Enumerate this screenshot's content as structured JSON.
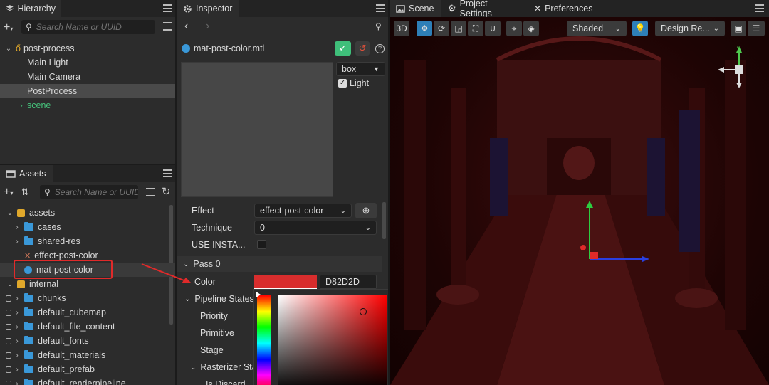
{
  "hierarchy": {
    "tab": "Hierarchy",
    "search_placeholder": "Search Name or UUID",
    "items": [
      {
        "label": "post-process"
      },
      {
        "label": "Main Light"
      },
      {
        "label": "Main Camera"
      },
      {
        "label": "PostProcess"
      },
      {
        "label": "scene"
      }
    ]
  },
  "assets": {
    "tab": "Assets",
    "search_placeholder": "Search Name or UUID",
    "items": [
      {
        "label": "assets"
      },
      {
        "label": "cases"
      },
      {
        "label": "shared-res"
      },
      {
        "label": "effect-post-color"
      },
      {
        "label": "mat-post-color"
      },
      {
        "label": "internal"
      },
      {
        "label": "chunks"
      },
      {
        "label": "default_cubemap"
      },
      {
        "label": "default_file_content"
      },
      {
        "label": "default_fonts"
      },
      {
        "label": "default_materials"
      },
      {
        "label": "default_prefab"
      },
      {
        "label": "default_renderpipeline"
      }
    ]
  },
  "inspector": {
    "tab": "Inspector",
    "file": "mat-post-color.mtl",
    "preview_shape": "box",
    "light_label": "Light",
    "effect_label": "Effect",
    "effect_value": "effect-post-color",
    "technique_label": "Technique",
    "technique_value": "0",
    "use_instancing_label": "USE INSTA...",
    "pass_label": "Pass 0",
    "color_label": "Color",
    "color_hex": "D82D2D",
    "pipeline_label": "Pipeline States",
    "priority_label": "Priority",
    "primitive_label": "Primitive",
    "stage_label": "Stage",
    "rasterizer_label": "Rasterizer Sta",
    "isdiscard_label": "Is Discard",
    "accent": "#d82d2d"
  },
  "scene": {
    "tabs": [
      "Scene",
      "Project Settings",
      "Preferences"
    ],
    "btn_3d": "3D",
    "shading": "Shaded",
    "resolution": "Design Re..."
  }
}
